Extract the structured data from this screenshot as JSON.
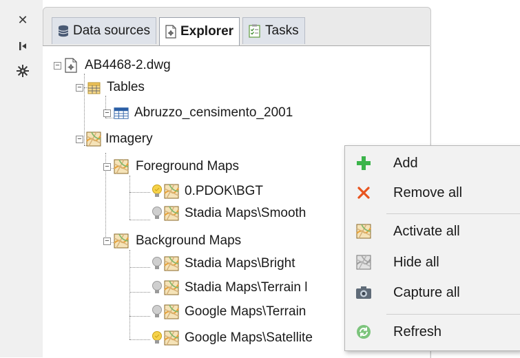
{
  "toolbar": {
    "buttons": [
      {
        "icon": "close-icon"
      },
      {
        "icon": "pin-icon"
      },
      {
        "icon": "settings-icon"
      }
    ]
  },
  "tabs": [
    {
      "label": "Data sources",
      "icon": "database-icon",
      "active": false
    },
    {
      "label": "Explorer",
      "icon": "drawing-file-icon",
      "active": true
    },
    {
      "label": "Tasks",
      "icon": "checklist-icon",
      "active": false
    }
  ],
  "tree": {
    "root": {
      "label": "AB4468-2.dwg"
    },
    "tables": {
      "label": "Tables"
    },
    "table_item": {
      "label": "Abruzzo_censimento_2001"
    },
    "imagery": {
      "label": "Imagery"
    },
    "foreground": {
      "label": "Foreground Maps"
    },
    "fg_items": [
      {
        "label": "0.PDOK\\BGT",
        "bulb": "on"
      },
      {
        "label": "Stadia Maps\\Smooth",
        "bulb": "off"
      }
    ],
    "background": {
      "label": "Background Maps"
    },
    "bg_items": [
      {
        "label": "Stadia Maps\\Bright",
        "bulb": "off"
      },
      {
        "label": "Stadia Maps\\Terrain l",
        "bulb": "off"
      },
      {
        "label": "Google Maps\\Terrain",
        "bulb": "off"
      },
      {
        "label": "Google Maps\\Satellite",
        "bulb": "on"
      }
    ]
  },
  "context_menu": {
    "items": [
      {
        "label": "Add",
        "icon": "plus-icon",
        "color": "#3cb44b"
      },
      {
        "label": "Remove all",
        "icon": "x-icon",
        "color": "#e8541f"
      },
      {
        "label": "Activate all",
        "icon": "map-icon"
      },
      {
        "label": "Hide all",
        "icon": "map-gray-icon"
      },
      {
        "label": "Capture all",
        "icon": "camera-icon"
      },
      {
        "label": "Refresh",
        "icon": "refresh-icon",
        "color": "#5cb85c"
      }
    ]
  }
}
